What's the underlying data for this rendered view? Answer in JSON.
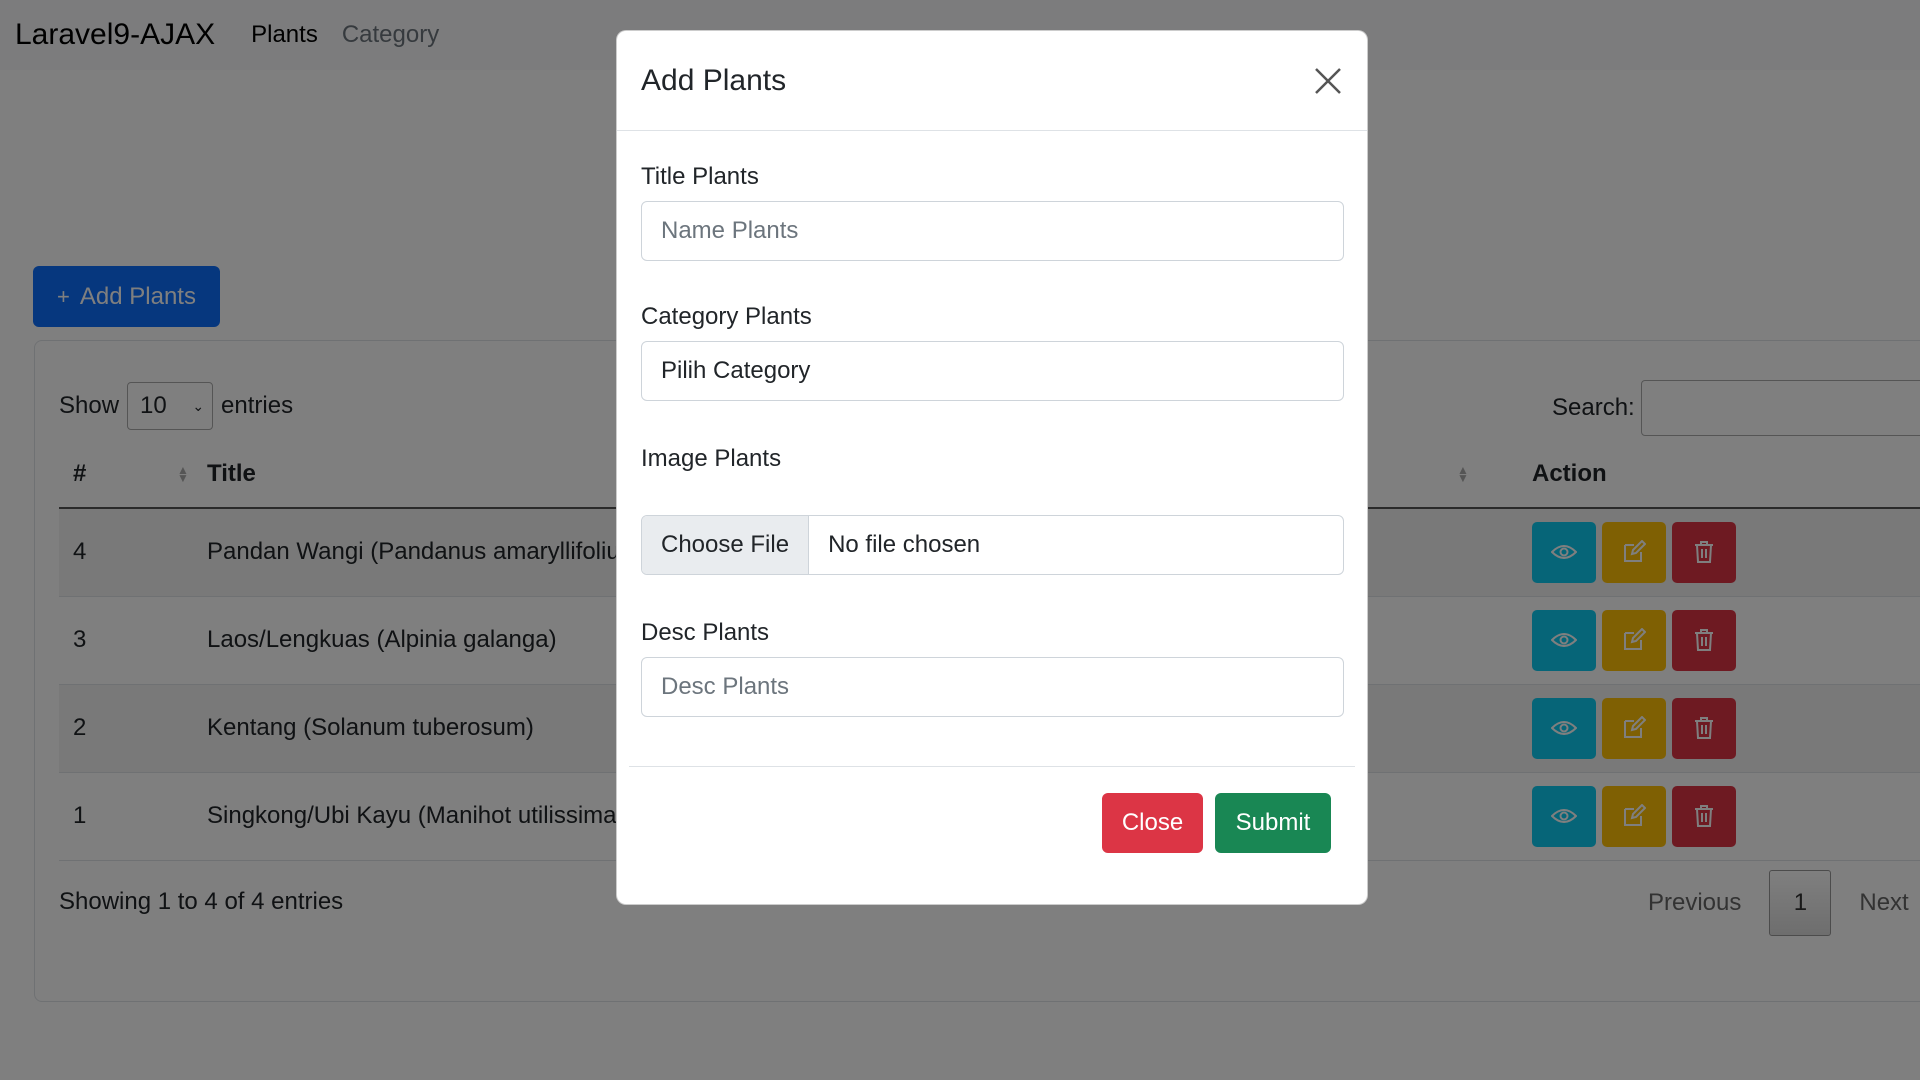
{
  "navbar": {
    "brand": "Laravel9-AJAX",
    "links": [
      {
        "label": "Plants",
        "active": true
      },
      {
        "label": "Category",
        "active": false
      }
    ]
  },
  "toolbar": {
    "add_button_label": "Add Plants",
    "add_icon": "plus-icon"
  },
  "datatable": {
    "length": {
      "show_label": "Show",
      "selected": "10",
      "entries_label": "entries"
    },
    "search": {
      "label": "Search:",
      "value": ""
    },
    "columns": [
      "#",
      "Title",
      "Action"
    ],
    "rows": [
      {
        "id": "4",
        "title": "Pandan Wangi (Pandanus amaryllifolius)"
      },
      {
        "id": "3",
        "title": "Laos/Lengkuas (Alpinia galanga)"
      },
      {
        "id": "2",
        "title": "Kentang (Solanum tuberosum)"
      },
      {
        "id": "1",
        "title": "Singkong/Ubi Kayu (Manihot utilissima)"
      }
    ],
    "action_icons": [
      "eye-icon",
      "edit-icon",
      "trash-icon"
    ],
    "info": "Showing 1 to 4 of 4 entries",
    "pagination": {
      "previous": "Previous",
      "current": "1",
      "next": "Next"
    }
  },
  "modal": {
    "title": "Add Plants",
    "fields": {
      "title": {
        "label": "Title Plants",
        "placeholder": "Name Plants"
      },
      "category": {
        "label": "Category Plants",
        "selected": "Pilih Category"
      },
      "image": {
        "label": "Image Plants",
        "button": "Choose File",
        "status": "No file chosen"
      },
      "desc": {
        "label": "Desc Plants",
        "placeholder": "Desc Plants"
      }
    },
    "close_label": "Close",
    "submit_label": "Submit"
  },
  "colors": {
    "primary": "#0d6efd",
    "info": "#0dcaf0",
    "warning": "#ffc107",
    "danger": "#dc3545",
    "success": "#198754"
  }
}
